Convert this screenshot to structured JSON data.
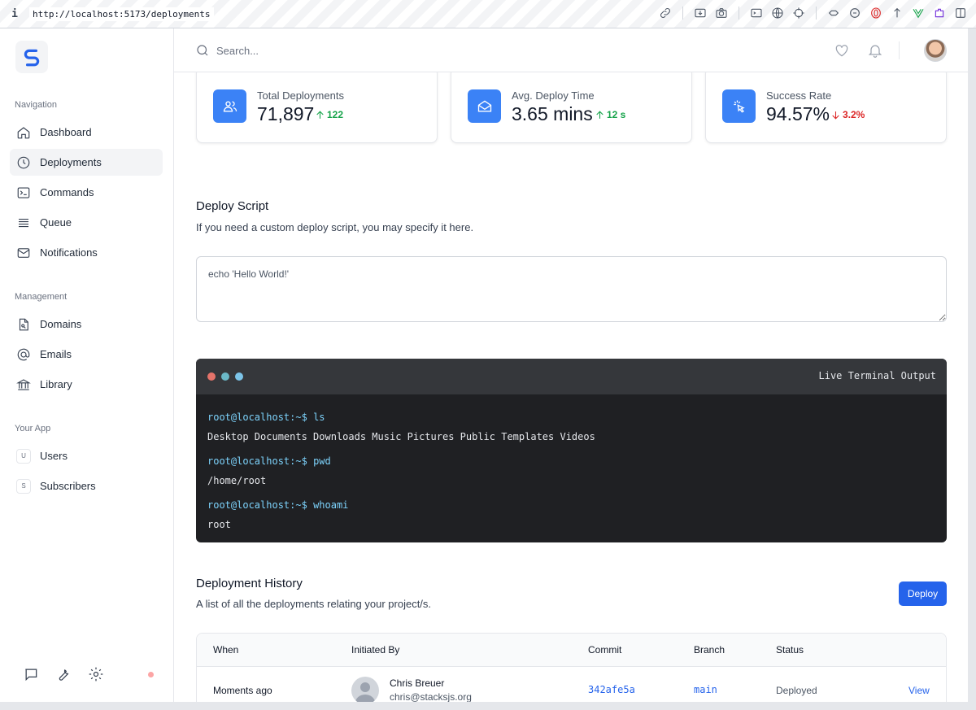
{
  "browser": {
    "info_glyph": "i",
    "url": "http://localhost:5173/deployments"
  },
  "sidebar": {
    "sections": [
      {
        "label": "Navigation"
      },
      {
        "label": "Management"
      },
      {
        "label": "Your App"
      }
    ],
    "navigation": [
      {
        "label": "Dashboard",
        "icon": "home-icon"
      },
      {
        "label": "Deployments",
        "icon": "clock-icon",
        "active": true
      },
      {
        "label": "Commands",
        "icon": "terminal-icon"
      },
      {
        "label": "Queue",
        "icon": "queue-icon"
      },
      {
        "label": "Notifications",
        "icon": "mail-icon"
      }
    ],
    "management": [
      {
        "label": "Domains",
        "icon": "document-icon"
      },
      {
        "label": "Emails",
        "icon": "at-icon"
      },
      {
        "label": "Library",
        "icon": "library-icon"
      }
    ],
    "your_app": [
      {
        "label": "Users",
        "letter": "U"
      },
      {
        "label": "Subscribers",
        "letter": "S"
      }
    ]
  },
  "header": {
    "search_placeholder": "Search..."
  },
  "stats": [
    {
      "label": "Total Deployments",
      "value": "71,897",
      "change": "122",
      "direction": "up"
    },
    {
      "label": "Avg. Deploy Time",
      "value": "3.65 mins",
      "change": "12 s",
      "direction": "up"
    },
    {
      "label": "Success Rate",
      "value": "94.57%",
      "change": "3.2%",
      "direction": "down"
    }
  ],
  "deploy_script": {
    "title": "Deploy Script",
    "description": "If you need a custom deploy script, you may specify it here.",
    "value": "echo 'Hello World!'"
  },
  "terminal": {
    "title": "Live Terminal Output",
    "dots": [
      "#e5736a",
      "#6bb8c7",
      "#7cc4e8"
    ],
    "entries": [
      {
        "prompt": "root@localhost:~$",
        "command": "ls",
        "output": "Desktop Documents Downloads Music Pictures Public Templates Videos"
      },
      {
        "prompt": "root@localhost:~$",
        "command": "pwd",
        "output": "/home/root"
      },
      {
        "prompt": "root@localhost:~$",
        "command": "whoami",
        "output": "root"
      }
    ]
  },
  "history": {
    "title": "Deployment History",
    "description": "A list of all the deployments relating your project/s.",
    "deploy_label": "Deploy",
    "columns": [
      "When",
      "Initiated By",
      "Commit",
      "Branch",
      "Status"
    ],
    "rows": [
      {
        "when": "Moments ago",
        "name": "Chris Breuer",
        "email": "chris@stacksjs.org",
        "commit": "342afe5a",
        "branch": "main",
        "status": "Deployed",
        "action": "View"
      }
    ]
  },
  "colors": {
    "accent": "#2563eb",
    "stat_icon_bg": "#3b82f6",
    "up": "#16a34a",
    "down": "#dc2626"
  }
}
